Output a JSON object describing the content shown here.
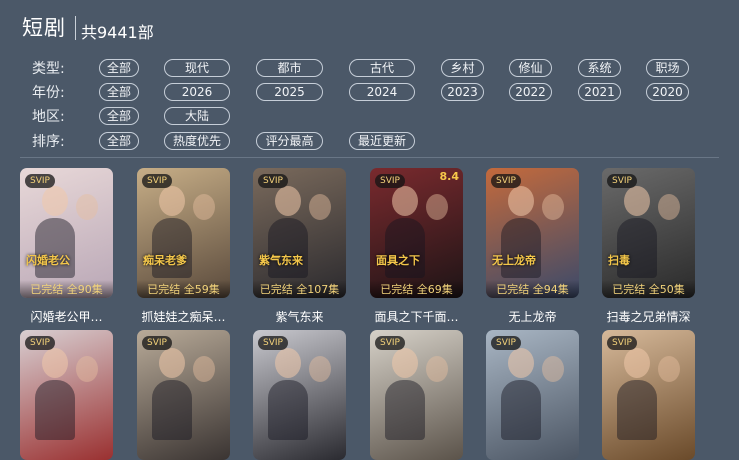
{
  "header": {
    "title": "短剧",
    "count": "共9441部"
  },
  "filters": {
    "type": {
      "label": "类型:",
      "options": [
        "全部",
        "现代",
        "都市",
        "古代",
        "乡村",
        "修仙",
        "系统",
        "职场"
      ]
    },
    "year": {
      "label": "年份:",
      "options": [
        "全部",
        "2026",
        "2025",
        "2024",
        "2023",
        "2022",
        "2021",
        "2020"
      ]
    },
    "region": {
      "label": "地区:",
      "options": [
        "全部",
        "大陆"
      ]
    },
    "sort": {
      "label": "排序:",
      "options": [
        "全部",
        "热度优先",
        "评分最高",
        "最近更新"
      ]
    }
  },
  "cards": [
    {
      "badge": "SVIP",
      "episodes": "已完结 全90集",
      "title": "闪婚老公甲…",
      "art": "闪婚老公",
      "colors": [
        "#e8d8d8",
        "#b9a7b6"
      ]
    },
    {
      "badge": "SVIP",
      "episodes": "已完结 全59集",
      "title": "抓娃娃之痴呆…",
      "art": "痴呆老爹",
      "colors": [
        "#c7ae87",
        "#5a4a3c"
      ]
    },
    {
      "badge": "SVIP",
      "episodes": "已完结 全107集",
      "title": "紫气东来",
      "art": "紫气东来",
      "colors": [
        "#7a6a5c",
        "#2b2a2e"
      ]
    },
    {
      "badge": "SVIP",
      "episodes": "已完结 全69集",
      "title": "面具之下千面…",
      "art": "面具之下",
      "score": "8.4",
      "colors": [
        "#7a2a2e",
        "#1d1416"
      ]
    },
    {
      "badge": "SVIP",
      "episodes": "已完结 全94集",
      "title": "无上龙帝",
      "art": "无上龙帝",
      "colors": [
        "#c46a3c",
        "#3b4a6a"
      ]
    },
    {
      "badge": "SVIP",
      "episodes": "已完结 全50集",
      "title": "扫毒之兄弟情深",
      "art": "扫毒",
      "colors": [
        "#6a6a6a",
        "#2a2a2a"
      ]
    },
    {
      "badge": "SVIP",
      "episodes": "",
      "title": "",
      "art": "",
      "colors": [
        "#d8cfd2",
        "#9a3030"
      ]
    },
    {
      "badge": "SVIP",
      "episodes": "",
      "title": "",
      "art": "",
      "colors": [
        "#b8aa98",
        "#3a3432"
      ]
    },
    {
      "badge": "SVIP",
      "episodes": "",
      "title": "",
      "art": "",
      "colors": [
        "#c9c9cf",
        "#2a2a30"
      ]
    },
    {
      "badge": "SVIP",
      "episodes": "",
      "title": "",
      "art": "",
      "colors": [
        "#d6d1c8",
        "#5b534a"
      ]
    },
    {
      "badge": "SVIP",
      "episodes": "",
      "title": "",
      "art": "",
      "colors": [
        "#a9b6c4",
        "#4b5563"
      ]
    },
    {
      "badge": "SVIP",
      "episodes": "",
      "title": "",
      "art": "",
      "colors": [
        "#d6b99a",
        "#6a4a2a"
      ]
    }
  ]
}
